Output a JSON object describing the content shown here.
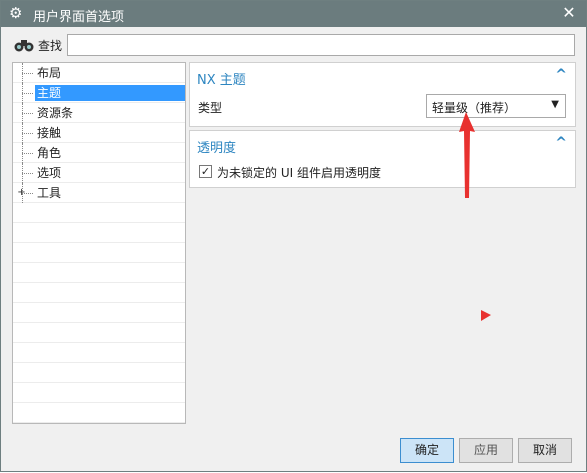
{
  "window": {
    "title": "用户界面首选项",
    "icons": {
      "app": "gear-icon",
      "close": "close-icon"
    },
    "close_glyph": "✕"
  },
  "search": {
    "label": "查找",
    "value": "",
    "placeholder": "",
    "icon": "binoculars-icon"
  },
  "tree": {
    "items": [
      {
        "label": "布局",
        "selected": false,
        "expandable": false
      },
      {
        "label": "主题",
        "selected": true,
        "expandable": false
      },
      {
        "label": "资源条",
        "selected": false,
        "expandable": false
      },
      {
        "label": "接触",
        "selected": false,
        "expandable": false
      },
      {
        "label": "角色",
        "selected": false,
        "expandable": false
      },
      {
        "label": "选项",
        "selected": false,
        "expandable": false
      },
      {
        "label": "工具",
        "selected": false,
        "expandable": true
      }
    ],
    "expand_glyph": "+"
  },
  "theme_panel": {
    "title": "NX 主题",
    "collapse_glyph": "^",
    "type_label": "类型",
    "type_value": "轻量级（推荐）",
    "dropdown_glyph": "▼"
  },
  "transparency_panel": {
    "title": "透明度",
    "collapse_glyph": "^",
    "checkbox_label": "为未锁定的 UI 组件启用透明度",
    "checked": true,
    "check_glyph": "✓"
  },
  "buttons": {
    "ok": "确定",
    "apply": "应用",
    "cancel": "取消"
  },
  "colors": {
    "titlebar": "#6b7c7e",
    "accent": "#2e86c1",
    "selection": "#3399ff",
    "annotation": "#e8312f"
  }
}
